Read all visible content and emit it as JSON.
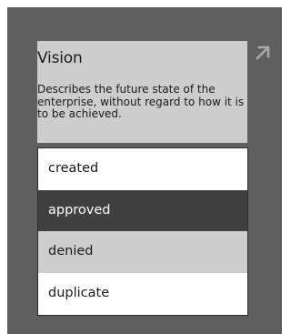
{
  "card": {
    "title": "Vision",
    "description": "Describes the future state of the enterprise, without regard to how it is to be achieved."
  },
  "icons": {
    "expand": "expand-arrow-icon"
  },
  "status_options": [
    {
      "label": "created",
      "state": "normal"
    },
    {
      "label": "approved",
      "state": "selected"
    },
    {
      "label": "denied",
      "state": "hover"
    },
    {
      "label": "duplicate",
      "state": "normal"
    }
  ],
  "colors": {
    "background": "#5f5f5f",
    "card": "#cdcdcd",
    "selected": "#404040",
    "hover": "#cdcdcd",
    "list_background": "#ffffff"
  }
}
